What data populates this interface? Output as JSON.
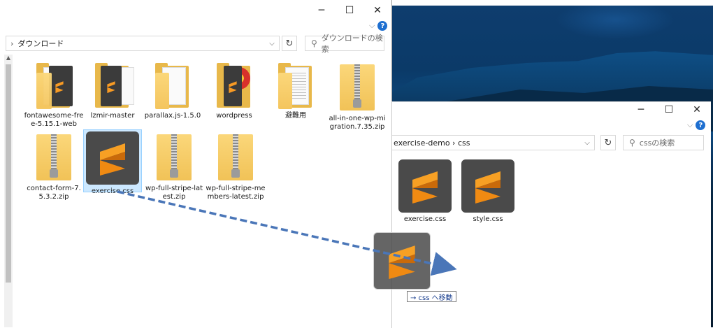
{
  "left_window": {
    "caption": {
      "minimize": "─",
      "maximize": "☐",
      "close": "✕"
    },
    "ribbon_chevron": "⌵",
    "help": "?",
    "path_arrow": "›",
    "address": "ダウンロード",
    "address_dropdown": "⌵",
    "refresh": "↻",
    "search_placeholder": "ダウンロードの検索",
    "scroll_up": "▲",
    "items": [
      {
        "label": "fontawesome-free-5.15.1-web",
        "icon": "folder-sublime-icon"
      },
      {
        "label": "lzmir-master",
        "icon": "folder-sublime-icon"
      },
      {
        "label": "parallax.js-1.5.0",
        "icon": "folder-icon"
      },
      {
        "label": "wordpress",
        "icon": "folder-media-icon"
      },
      {
        "label": "避難用",
        "icon": "folder-document-icon"
      },
      {
        "label": "all-in-one-wp-migration.7.35.zip",
        "icon": "zip-folder-icon"
      },
      {
        "label": "contact-form-7.5.3.2.zip",
        "icon": "zip-folder-icon"
      },
      {
        "label": "exercise.css",
        "icon": "sublime-file-icon",
        "selected": true
      },
      {
        "label": "wp-full-stripe-latest.zip",
        "icon": "zip-folder-icon"
      },
      {
        "label": "wp-full-stripe-members-latest.zip",
        "icon": "zip-folder-icon"
      }
    ]
  },
  "right_window": {
    "caption": {
      "minimize": "─",
      "maximize": "☐",
      "close": "✕"
    },
    "ribbon_chevron": "⌵",
    "help": "?",
    "breadcrumb": "exercise-demo  ›  css",
    "address_dropdown": "⌵",
    "refresh": "↻",
    "search_placeholder": "cssの検索",
    "items": [
      {
        "label": "exercise.css",
        "icon": "sublime-file-icon"
      },
      {
        "label": "style.css",
        "icon": "sublime-file-icon"
      }
    ]
  },
  "drag": {
    "tooltip": "→ css へ移動",
    "arrow_color": "#4a76b8"
  },
  "colors": {
    "selection": "#cce8ff",
    "sublime_orange": "#f79a24",
    "folder_yellow": "#f4c55e"
  }
}
